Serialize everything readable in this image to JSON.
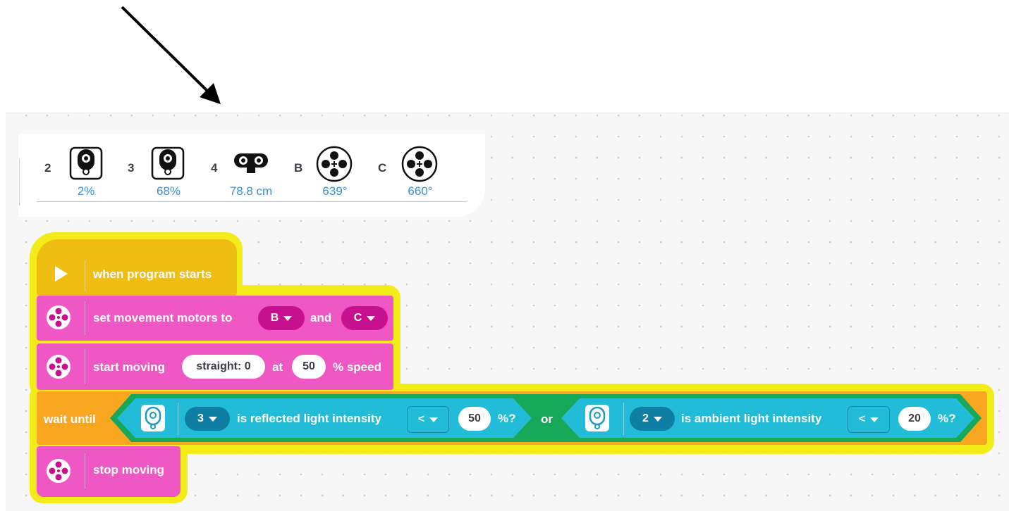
{
  "sensors": [
    {
      "port": "2",
      "icon": "color-sensor-icon",
      "value": "2%"
    },
    {
      "port": "3",
      "icon": "color-sensor-icon",
      "value": "68%"
    },
    {
      "port": "4",
      "icon": "distance-sensor-icon",
      "value": "78.8 cm"
    },
    {
      "port": "B",
      "icon": "motor-icon",
      "value": "639°"
    },
    {
      "port": "C",
      "icon": "motor-icon",
      "value": "660°"
    }
  ],
  "blocks": {
    "start": {
      "label": "when program starts"
    },
    "set_motors": {
      "label": "set movement motors to",
      "port1": "B",
      "and": "and",
      "port2": "C"
    },
    "start_moving": {
      "label": "start moving",
      "steer": "straight: 0",
      "at": "at",
      "speed": "50",
      "unit": "% speed"
    },
    "wait_until": {
      "label": "wait until",
      "cond1": {
        "port": "3",
        "text": "is reflected light intensity",
        "op": "<",
        "value": "50",
        "unit": "%?"
      },
      "or": "or",
      "cond2": {
        "port": "2",
        "text": "is ambient light intensity",
        "op": "<",
        "value": "20",
        "unit": "%?"
      }
    },
    "stop": {
      "label": "stop moving"
    }
  },
  "colors": {
    "events": "#f0be12",
    "movement": "#ef57c4",
    "control": "#f9a620",
    "sensors": "#23bcd8",
    "operators": "#18a85a",
    "highlight": "#f4ec19",
    "sensor_value": "#3b8fd6"
  }
}
